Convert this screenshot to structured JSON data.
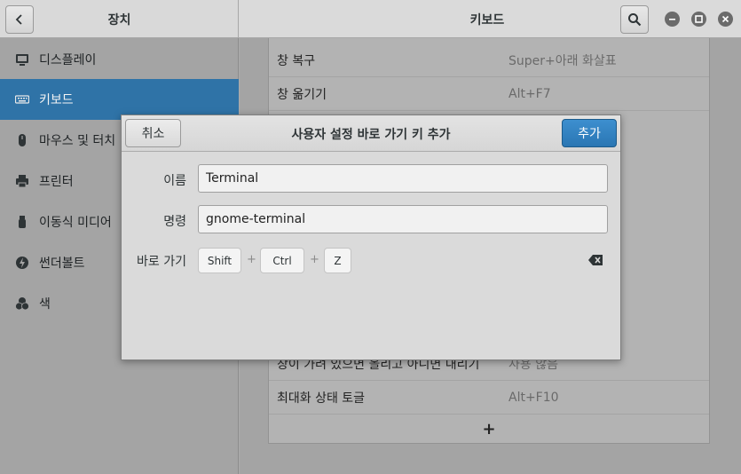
{
  "sidebar_header": {
    "title": "장치",
    "back_icon": "chevron-left-icon"
  },
  "main_header": {
    "title": "키보드",
    "search_icon": "search-icon"
  },
  "window_controls": [
    "minimize-icon",
    "maximize-icon",
    "close-icon"
  ],
  "sidebar": {
    "items": [
      {
        "label": "디스플레이",
        "icon": "display-icon",
        "selected": false
      },
      {
        "label": "키보드",
        "icon": "keyboard-icon",
        "selected": true
      },
      {
        "label": "마우스 및 터치",
        "icon": "mouse-icon",
        "selected": false
      },
      {
        "label": "프린터",
        "icon": "printer-icon",
        "selected": false
      },
      {
        "label": "이동식 미디어",
        "icon": "media-icon",
        "selected": false
      },
      {
        "label": "썬더볼트",
        "icon": "thunderbolt-icon",
        "selected": false
      },
      {
        "label": "색",
        "icon": "color-icon",
        "selected": false
      }
    ]
  },
  "shortcuts": {
    "top_rows": [
      {
        "name": "창 복구",
        "accel": "Super+아래 화살표"
      },
      {
        "name": "창 옮기기",
        "accel": "Alt+F7"
      }
    ],
    "bottom_rows": [
      {
        "name": "창이 가려 있으면 올리고 아니면 내리기",
        "accel": "사용 않음"
      },
      {
        "name": "최대화 상태 토글",
        "accel": "Alt+F10"
      }
    ],
    "add_label": "+"
  },
  "dialog": {
    "title": "사용자 설정 바로 가기 키 추가",
    "cancel_label": "취소",
    "add_label": "추가",
    "name_label": "이름",
    "name_value": "Terminal",
    "command_label": "명령",
    "command_value": "gnome-terminal",
    "shortcut_label": "바로 가기",
    "keys": [
      "Shift",
      "Ctrl",
      "Z"
    ],
    "key_separator": "+",
    "accent_color": "#2f7bbd"
  }
}
